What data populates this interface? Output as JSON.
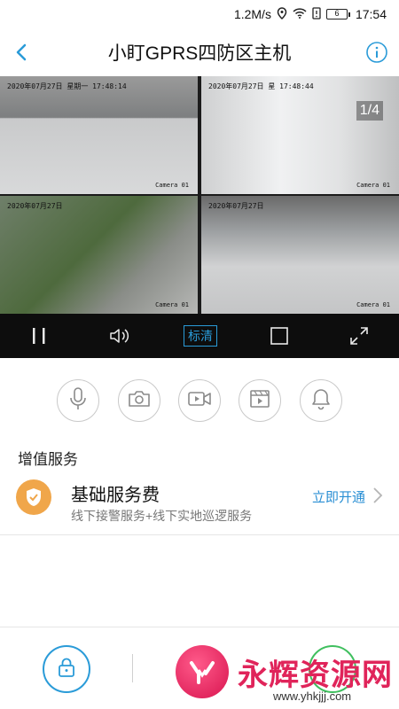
{
  "status_bar": {
    "network_speed": "1.2M/s",
    "battery": "6",
    "time": "17:54"
  },
  "header": {
    "title": "小盯GPRS四防区主机"
  },
  "video": {
    "page_indicator": "1/4",
    "cells": [
      {
        "timestamp": "2020年07月27日 星期一 17:48:14",
        "camera": "Camera 01"
      },
      {
        "timestamp": "2020年07月27日 星 17:48:44",
        "camera": "Camera 01"
      },
      {
        "timestamp": "2020年07月27日",
        "camera": "Camera 01"
      },
      {
        "timestamp": "2020年07月27日",
        "camera": "Camera 01"
      }
    ]
  },
  "controls": {
    "quality_label": "标清"
  },
  "services": {
    "section_title": "增值服务",
    "item_name": "基础服务费",
    "item_desc": "线下接警服务+线下实地巡逻服务",
    "item_action": "立即开通"
  },
  "watermark": {
    "brand": "永辉资源网",
    "url": "www.yhkjjj.com"
  },
  "colors": {
    "accent_blue": "#2a9bd8",
    "link_blue": "#2a8fd4",
    "service_orange": "#f0a64a",
    "green": "#3fbf5e",
    "watermark_red": "#e0245a"
  }
}
